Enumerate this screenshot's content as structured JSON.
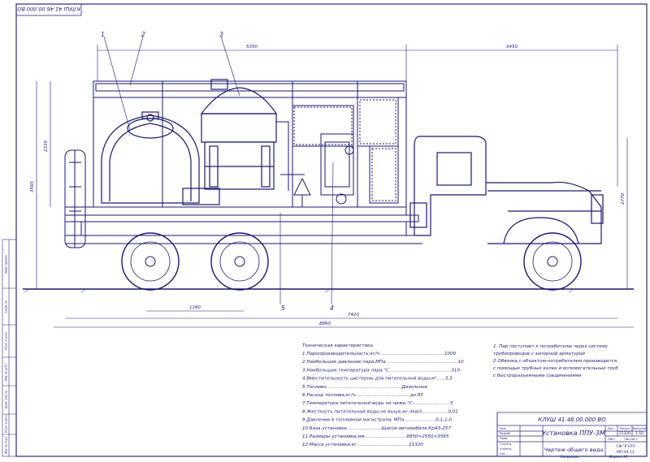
{
  "stamp_top": "КЛУШ 41.46.00.000 ВО",
  "part_numbers": [
    "1",
    "2",
    "3",
    "4",
    "5"
  ],
  "dimensions": {
    "top_left": "5350",
    "top_right": "3450",
    "height_left_1": "2335",
    "height_left_2": "3565",
    "height_right": "2770",
    "bottom_1": "1160",
    "bottom_2": "7420",
    "bottom_total": "8860"
  },
  "specs_title": "Техническая характеристика",
  "specs": [
    "1.Паропроизводительность,кг/ч.............................................1000",
    "2.Наибольшее давление пара,МПа..................................................10",
    "3.Наибольшая  температура пара,°C...........................................310",
    "4.Вместительность цистерны для питательной воды,м³......5,5",
    "5.Топливо....................................................Дизельное",
    "6.Расход топлива,кг/ч......................................до 85",
    "7.Температура питательной воды не ниже,°C..........................5",
    "8.Жесткость питательной воды не выше,мг-экв/л..................0,01",
    "9.Давление в топливной магистрали, МПа......................0,1-1,0",
    "10.База установки........................Шасси автомобиля КрАЗ-257",
    "11.Размеры установки,мм.............................8850×2550×3565",
    "12.Масса установки,кг....................................21320"
  ],
  "notes": [
    "1. Пар поступает к потребителю через систему",
    "трубопроводов с запорной арматурой",
    "2.Обвязка с объектом-потребителем производится",
    "с помощью трубных колен и вспомогательных труб",
    "с быстроразъемными соединениями"
  ],
  "title_block": {
    "doc_number": "КЛУШ 41.46.00.000 ВО",
    "name": "Установка ППУ-3М",
    "sheet_name": "Чертеж общего вида",
    "mass": "21320",
    "scale": "1:10",
    "org_1": "СФ ЧГНТУ",
    "org_2": "МП-04-11",
    "copied": "Копировал",
    "format": "Формат  А1",
    "col_lit": "Лит.",
    "col_mass": "Масса",
    "col_scale": "Масштаб",
    "col_sheet": "Лист",
    "col_sheets": "Листов 1",
    "rows": [
      "Изм",
      "Разраб.",
      "Пров.",
      "Т.контр.",
      "Н.контр.",
      "Утв."
    ]
  },
  "side_stamps": [
    "Перв. примен.",
    "Справ. №",
    "Подп. и дата",
    "Инв. № дубл.",
    "Взам. инв. №",
    "Подп. и дата",
    "Инв. № подл."
  ],
  "colors": {
    "ink": "#1a1a6e",
    "paper": "#ffffff",
    "frame": "#2b2b7a"
  }
}
